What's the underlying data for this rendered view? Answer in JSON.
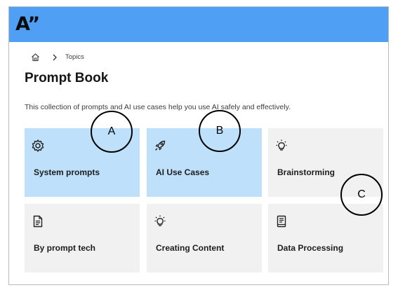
{
  "header": {
    "logo_text": "A”",
    "accent_color": "#4f9ff5"
  },
  "breadcrumb": {
    "home_icon": "home-icon",
    "separator_icon": "chevron-right-icon",
    "current": "Topics"
  },
  "page": {
    "title": "Prompt Book",
    "intro": "This collection of prompts and AI use cases help you use AI safely and effectively."
  },
  "cards": [
    {
      "label": "System prompts",
      "icon": "gear-icon",
      "selected": true
    },
    {
      "label": "AI Use Cases",
      "icon": "rocket-icon",
      "selected": true
    },
    {
      "label": "Brainstorming",
      "icon": "lightbulb-icon",
      "selected": false
    },
    {
      "label": "By prompt tech",
      "icon": "document-icon",
      "selected": false
    },
    {
      "label": "Creating Content",
      "icon": "lightbulb-icon",
      "selected": false
    },
    {
      "label": "Data Processing",
      "icon": "book-icon",
      "selected": false
    }
  ],
  "colors": {
    "card_selected": "#bfe0fa",
    "card_default": "#f1f1f1"
  },
  "markers": [
    {
      "label": "A"
    },
    {
      "label": "B"
    },
    {
      "label": "C"
    }
  ]
}
